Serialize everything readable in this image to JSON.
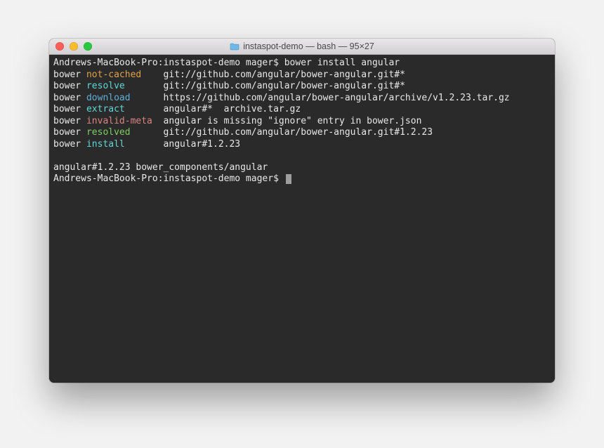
{
  "window": {
    "title": "instaspot-demo — bash — 95×27"
  },
  "colors": {
    "traffic_red": "#ff5f57",
    "traffic_yellow": "#ffbd2e",
    "traffic_green": "#28c940",
    "term_bg": "#2a2a2a",
    "term_fg": "#e8e8e8",
    "cyan": "#5fd7d7",
    "green": "#7ccf5f",
    "orange": "#e0a24a",
    "red": "#d98383",
    "path_blue": "#5fafd7"
  },
  "terminal": {
    "prompt_initial": "Andrews-MacBook-Pro:instaspot-demo mager$ ",
    "command": "bower install angular",
    "bower_label": "bower",
    "status_pad": 14,
    "lines": [
      {
        "status": "not-cached",
        "status_class": "col-orange",
        "msg": "git://github.com/angular/bower-angular.git#*"
      },
      {
        "status": "resolve",
        "status_class": "col-cyan",
        "msg": "git://github.com/angular/bower-angular.git#*"
      },
      {
        "status": "download",
        "status_class": "col-path",
        "msg": "https://github.com/angular/bower-angular/archive/v1.2.23.tar.gz"
      },
      {
        "status": "extract",
        "status_class": "col-cyan",
        "msg": "angular#*  archive.tar.gz"
      },
      {
        "status": "invalid-meta",
        "status_class": "col-red",
        "msg": "angular is missing \"ignore\" entry in bower.json"
      },
      {
        "status": "resolved",
        "status_class": "col-green",
        "msg": "git://github.com/angular/bower-angular.git#1.2.23"
      },
      {
        "status": "install",
        "status_class": "col-cyan",
        "msg": "angular#1.2.23"
      }
    ],
    "footer1": "angular#1.2.23 bower_components/angular",
    "prompt_final": "Andrews-MacBook-Pro:instaspot-demo mager$ "
  }
}
